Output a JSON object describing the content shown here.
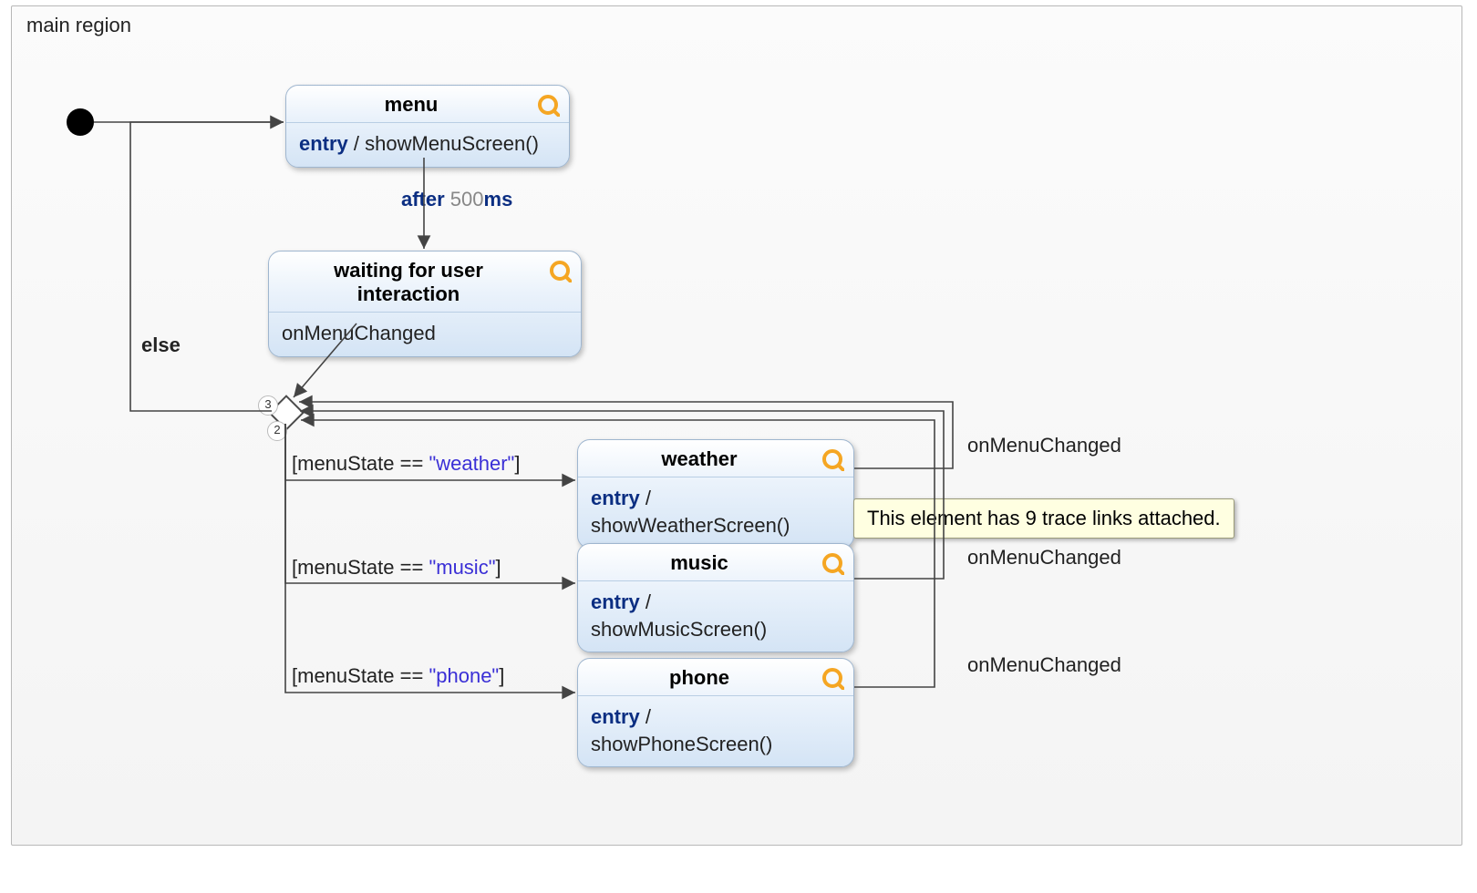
{
  "region": {
    "title": "main region"
  },
  "states": {
    "menu": {
      "title": "menu",
      "entry_kw": "entry",
      "sep": " / ",
      "action": "showMenuScreen()"
    },
    "waiting": {
      "title": "waiting for user interaction",
      "body_text": "onMenuChanged"
    },
    "weather": {
      "title": "weather",
      "entry_kw": "entry",
      "sep": " /",
      "action": "showWeatherScreen()"
    },
    "music": {
      "title": "music",
      "entry_kw": "entry",
      "sep": " /",
      "action": "showMusicScreen()"
    },
    "phone": {
      "title": "phone",
      "entry_kw": "entry",
      "sep": " /",
      "action": "showPhoneScreen()"
    }
  },
  "transition_labels": {
    "after_kw": "after ",
    "after_val": "500",
    "after_unit": "ms",
    "else": "else",
    "weather_guard_l": "[menuState == ",
    "weather_guard_s": "\"weather\"",
    "weather_guard_r": "]",
    "music_guard_l": "[menuState == ",
    "music_guard_s": "\"music\"",
    "music_guard_r": "]",
    "phone_guard_l": "[menuState == ",
    "phone_guard_s": "\"phone\"",
    "phone_guard_r": "]",
    "onMenuChanged": "onMenuChanged"
  },
  "choice_badges": {
    "top": "3",
    "bottom": "2"
  },
  "tooltip": {
    "text": "This element has 9 trace links attached."
  }
}
